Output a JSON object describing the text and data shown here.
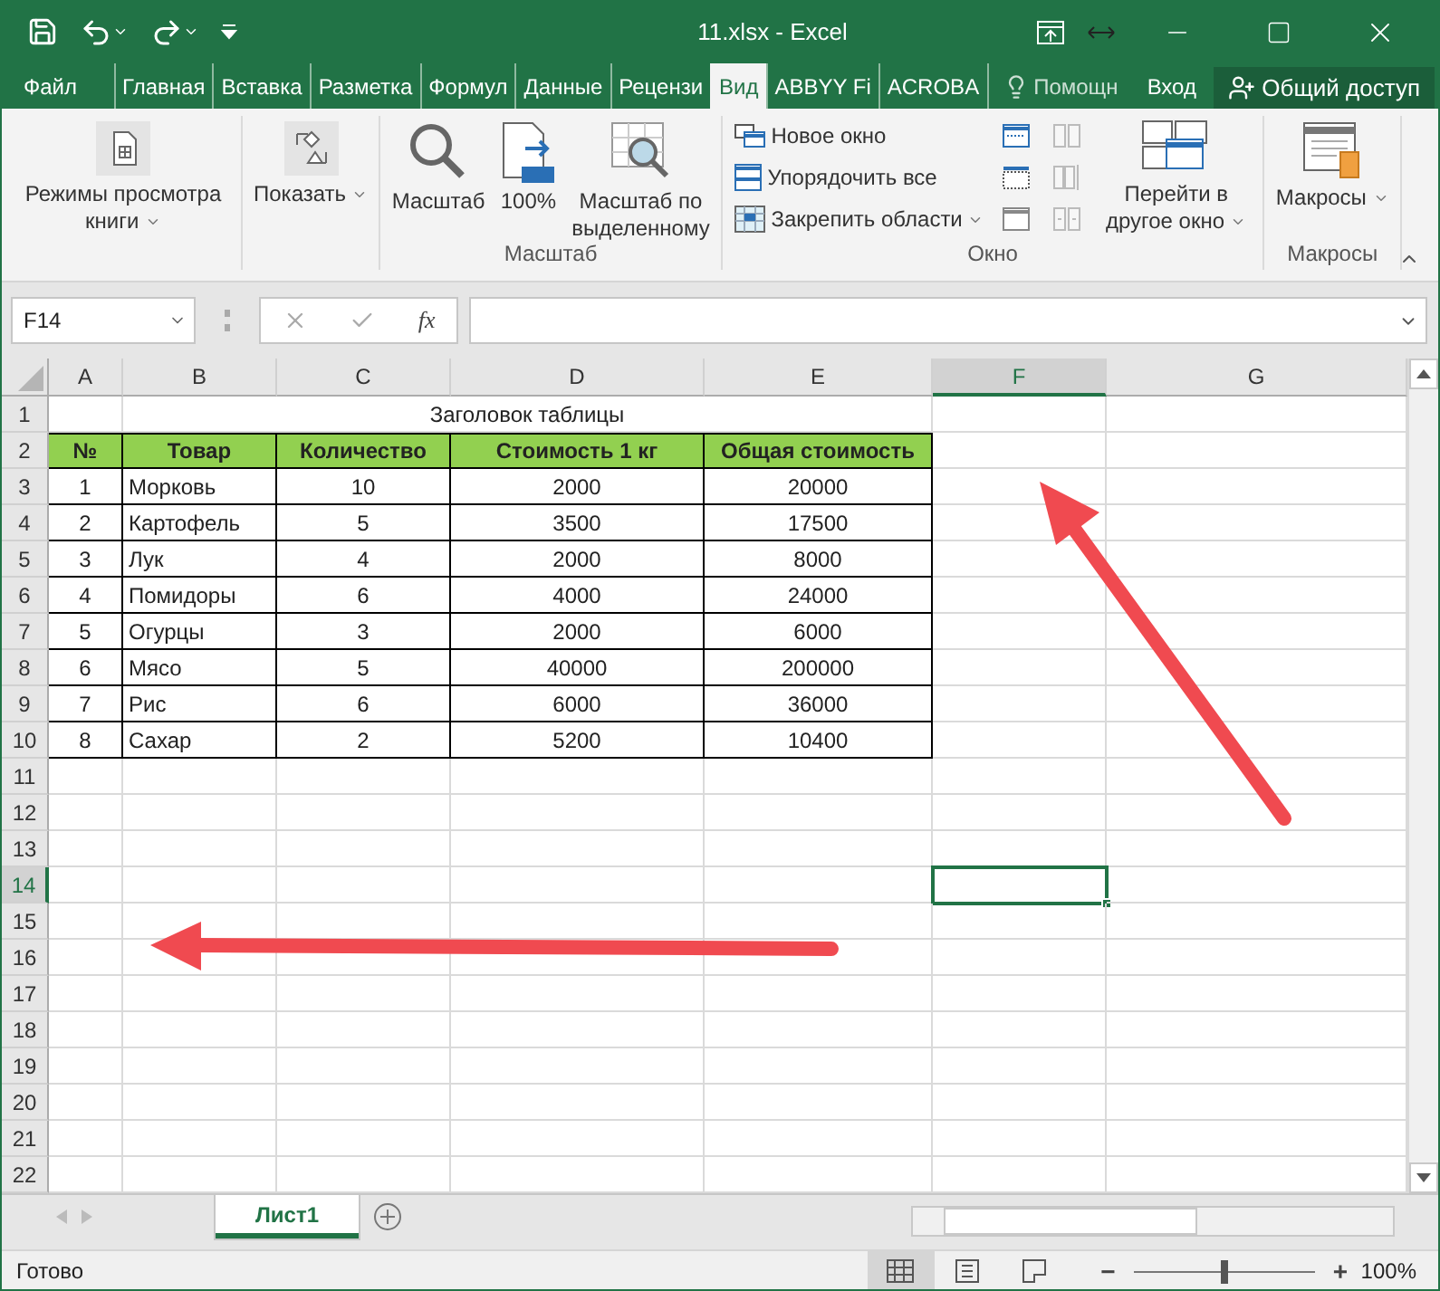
{
  "window": {
    "title": "11.xlsx - Excel"
  },
  "tabs": [
    {
      "label": "Файл",
      "selected": false
    },
    {
      "label": "Главная",
      "selected": false
    },
    {
      "label": "Вставка",
      "selected": false
    },
    {
      "label": "Разметка",
      "selected": false
    },
    {
      "label": "Формул",
      "selected": false
    },
    {
      "label": "Данные",
      "selected": false
    },
    {
      "label": "Рецензи",
      "selected": false
    },
    {
      "label": "Вид",
      "selected": true
    },
    {
      "label": "ABBYY Fi",
      "selected": false
    },
    {
      "label": "ACROBA",
      "selected": false
    }
  ],
  "tell_me": "Помощн",
  "sign_in": "Вход",
  "share": "Общий доступ",
  "ribbon": {
    "groups": [
      {
        "buttons": [
          {
            "kind": "large",
            "label": "Режимы просмотра книги",
            "dropdown": true,
            "disabled": false
          }
        ]
      },
      {
        "buttons": [
          {
            "kind": "large",
            "label": "Показать",
            "dropdown": true,
            "disabled": false
          }
        ]
      },
      {
        "label": "Масштаб",
        "buttons": [
          {
            "kind": "large",
            "label": "Масштаб",
            "dropdown": false,
            "disabled": false
          },
          {
            "kind": "large",
            "label": "100%",
            "dropdown": false,
            "disabled": false
          },
          {
            "kind": "large",
            "label": "Масштаб по выделенному",
            "dropdown": false,
            "disabled": false
          }
        ]
      },
      {
        "label": "Окно",
        "buttons": [
          {
            "kind": "small",
            "label": "Новое окно",
            "dropdown": false,
            "disabled": false
          },
          {
            "kind": "small",
            "label": "Упорядочить все",
            "dropdown": false,
            "disabled": false
          },
          {
            "kind": "small",
            "label": "Закрепить области",
            "dropdown": true,
            "disabled": false
          },
          {
            "kind": "icon",
            "disabled": false
          },
          {
            "kind": "icon",
            "disabled": false
          },
          {
            "kind": "icon",
            "disabled": false
          },
          {
            "kind": "icon",
            "disabled": true
          },
          {
            "kind": "icon",
            "disabled": true
          },
          {
            "kind": "icon",
            "disabled": true
          },
          {
            "kind": "large",
            "label": "Перейти в другое окно",
            "dropdown": true,
            "disabled": false
          }
        ]
      },
      {
        "label": "Макросы",
        "buttons": [
          {
            "kind": "large",
            "label": "Макросы",
            "dropdown": true,
            "disabled": false
          }
        ]
      }
    ]
  },
  "formula_bar": {
    "name_box": "F14",
    "function_label": "fx"
  },
  "grid": {
    "columns": [
      {
        "letter": "A",
        "selected": false
      },
      {
        "letter": "B",
        "selected": false
      },
      {
        "letter": "C",
        "selected": false
      },
      {
        "letter": "D",
        "selected": false
      },
      {
        "letter": "E",
        "selected": false
      },
      {
        "letter": "F",
        "selected": true
      },
      {
        "letter": "G",
        "selected": false
      }
    ],
    "rows": [
      {
        "number": "1",
        "selected": false
      },
      {
        "number": "2",
        "selected": false
      },
      {
        "number": "3",
        "selected": false
      },
      {
        "number": "4",
        "selected": false
      },
      {
        "number": "5",
        "selected": false
      },
      {
        "number": "6",
        "selected": false
      },
      {
        "number": "7",
        "selected": false
      },
      {
        "number": "8",
        "selected": false
      },
      {
        "number": "9",
        "selected": false
      },
      {
        "number": "10",
        "selected": false
      },
      {
        "number": "11",
        "selected": false
      },
      {
        "number": "12",
        "selected": false
      },
      {
        "number": "13",
        "selected": false
      },
      {
        "number": "14",
        "selected": true
      },
      {
        "number": "15",
        "selected": false
      },
      {
        "number": "16",
        "selected": false
      },
      {
        "number": "17",
        "selected": false
      },
      {
        "number": "18",
        "selected": false
      },
      {
        "number": "19",
        "selected": false
      },
      {
        "number": "20",
        "selected": false
      },
      {
        "number": "21",
        "selected": false
      },
      {
        "number": "22",
        "selected": false
      }
    ]
  },
  "sheet_table": {
    "title": "Заголовок таблицы",
    "columns": [
      "№",
      "Товар",
      "Количество",
      "Стоимость 1 кг",
      "Общая стоимость"
    ],
    "rows": [
      [
        "1",
        "Морковь",
        "10",
        "2000",
        "20000"
      ],
      [
        "2",
        "Картофель",
        "5",
        "3500",
        "17500"
      ],
      [
        "3",
        "Лук",
        "4",
        "2000",
        "8000"
      ],
      [
        "4",
        "Помидоры",
        "6",
        "4000",
        "24000"
      ],
      [
        "5",
        "Огурцы",
        "3",
        "2000",
        "6000"
      ],
      [
        "6",
        "Мясо",
        "5",
        "40000",
        "200000"
      ],
      [
        "7",
        "Рис",
        "6",
        "6000",
        "36000"
      ],
      [
        "8",
        "Сахар",
        "2",
        "5200",
        "10400"
      ]
    ]
  },
  "sheet_tabs": [
    {
      "label": "Лист1",
      "selected": true
    }
  ],
  "status_bar": {
    "status": "Готово",
    "views": [
      {
        "selected": true
      },
      {
        "selected": false
      },
      {
        "selected": false
      }
    ],
    "zoom_out": "−",
    "zoom_in": "+",
    "zoom_slider": {
      "level": 0.5
    },
    "zoom": "100%"
  }
}
